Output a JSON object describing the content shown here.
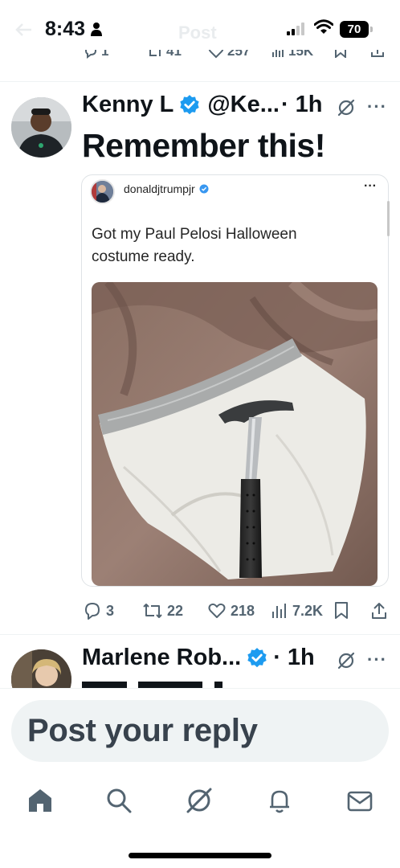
{
  "status_bar": {
    "time": "8:43",
    "battery": "70",
    "ghost_title": "Post"
  },
  "prev_tweet_actions": {
    "replies": "1",
    "reposts": "41",
    "likes": "257",
    "views": "15K"
  },
  "tweet": {
    "author_name": "Kenny L",
    "handle": "@Ke...",
    "time": "· 1h",
    "text": "Remember this!",
    "embed": {
      "username": "donaldjtrumpjr",
      "caption": "Got my Paul Pelosi Halloween costume ready."
    },
    "actions": {
      "replies": "3",
      "reposts": "22",
      "likes": "218",
      "views": "7.2K"
    }
  },
  "next_tweet": {
    "author_name": "Marlene Rob...",
    "time": "· 1h"
  },
  "reply": {
    "placeholder": "Post your reply"
  },
  "tab_bar": {
    "icons": [
      "home-icon",
      "search-icon",
      "grok-icon",
      "notifications-icon",
      "messages-icon"
    ]
  },
  "colors": {
    "verified_blue": "#1d9bf0",
    "muted_gray": "#536471",
    "text_dark": "#0f1419"
  }
}
